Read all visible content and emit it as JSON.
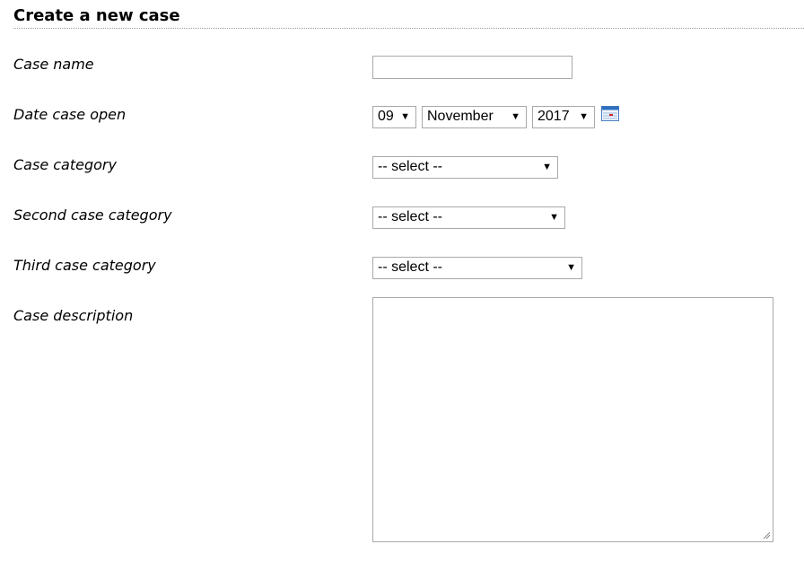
{
  "form": {
    "title": "Create a new case",
    "case_name": {
      "label": "Case name",
      "value": ""
    },
    "date_open": {
      "label": "Date case open",
      "day": "09",
      "month": "November",
      "year": "2017",
      "calendar_icon": "calendar-icon"
    },
    "case_category": {
      "label": "Case category",
      "selected": "-- select --"
    },
    "second_case_category": {
      "label": "Second case category",
      "selected": "-- select --"
    },
    "third_case_category": {
      "label": "Third case category",
      "selected": "-- select --"
    },
    "case_description": {
      "label": "Case description",
      "value": ""
    }
  },
  "icons": {
    "dropdown": "▼"
  }
}
